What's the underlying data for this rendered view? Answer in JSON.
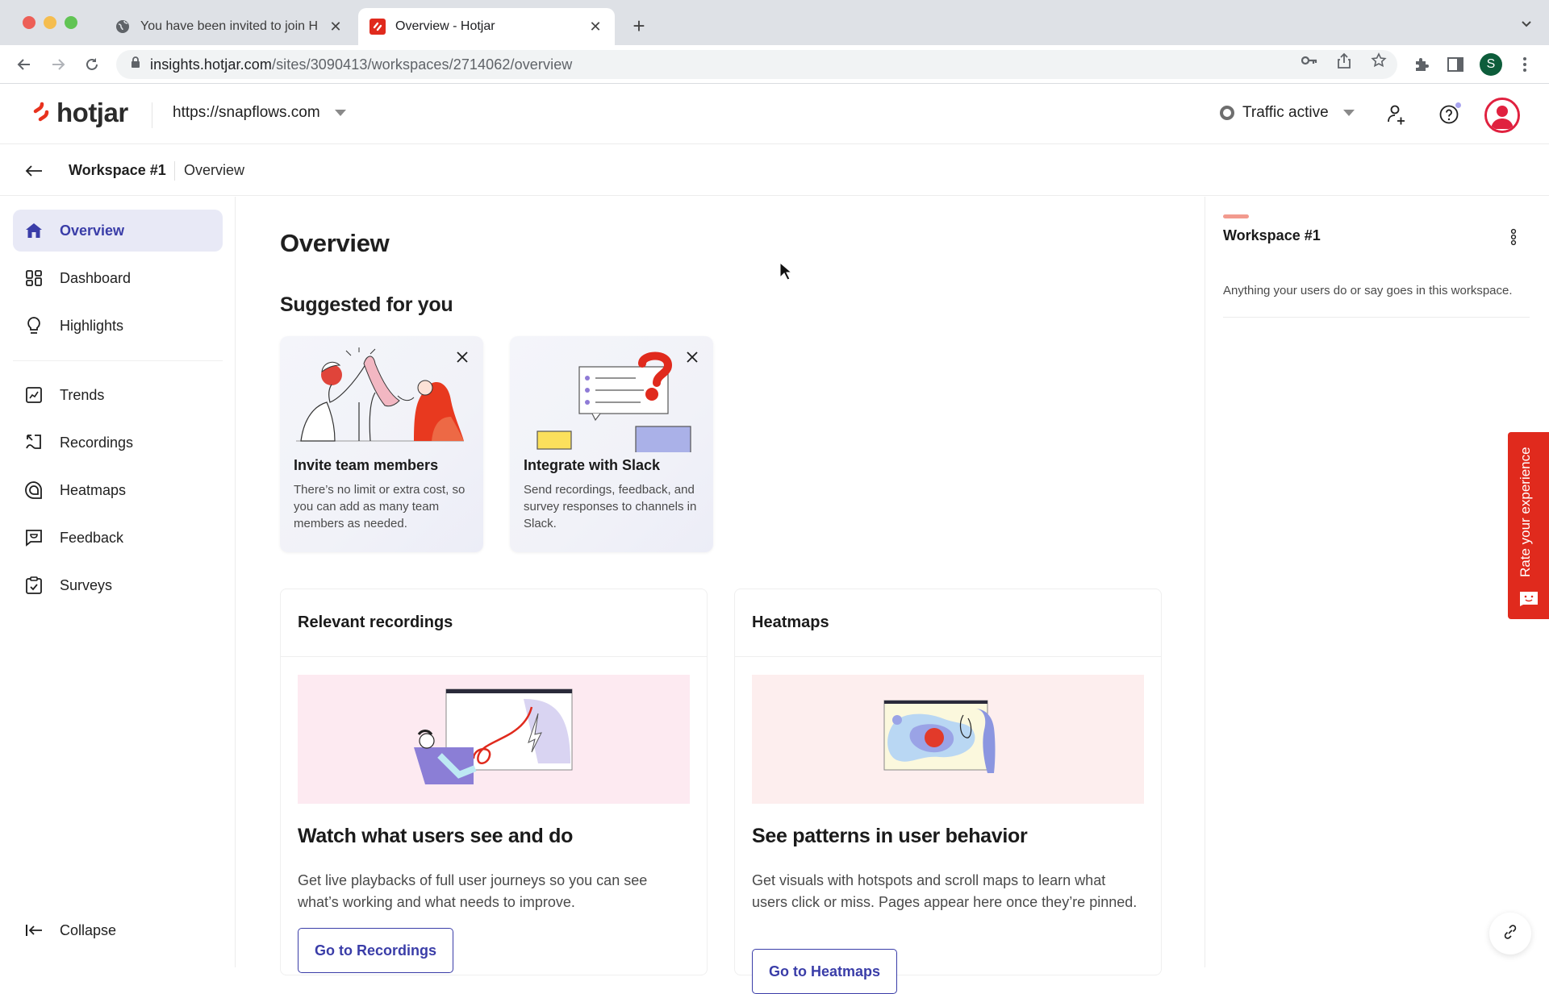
{
  "browser": {
    "tabs": [
      {
        "title": "You have been invited to join H",
        "icon": "globe-icon",
        "active": false
      },
      {
        "title": "Overview - Hotjar",
        "icon": "hotjar-favicon",
        "active": true
      }
    ],
    "url_host": "insights.hotjar.com",
    "url_path": "/sites/3090413/workspaces/2714062/overview",
    "profile_initial": "S"
  },
  "header": {
    "logo_text": "hotjar",
    "site": "https://snapflows.com",
    "traffic_status": "Traffic active"
  },
  "breadcrumb": {
    "workspace": "Workspace #1",
    "page": "Overview"
  },
  "sidebar": {
    "items": [
      {
        "label": "Overview",
        "icon": "home-icon",
        "active": true
      },
      {
        "label": "Dashboard",
        "icon": "dashboard-icon",
        "active": false
      },
      {
        "label": "Highlights",
        "icon": "lightbulb-icon",
        "active": false
      },
      {
        "label": "Trends",
        "icon": "trends-icon",
        "active": false
      },
      {
        "label": "Recordings",
        "icon": "recordings-icon",
        "active": false
      },
      {
        "label": "Heatmaps",
        "icon": "heatmaps-icon",
        "active": false
      },
      {
        "label": "Feedback",
        "icon": "feedback-icon",
        "active": false
      },
      {
        "label": "Surveys",
        "icon": "surveys-icon",
        "active": false
      }
    ],
    "collapse_label": "Collapse"
  },
  "main": {
    "title": "Overview",
    "suggested_title": "Suggested for you",
    "suggestions": [
      {
        "title": "Invite team members",
        "description": "There’s no limit or extra cost, so you can add as many team members as needed."
      },
      {
        "title": "Integrate with Slack",
        "description": "Send recordings, feedback, and survey responses to channels in Slack."
      }
    ],
    "features": [
      {
        "header": "Relevant recordings",
        "title": "Watch what users see and do",
        "description": "Get live playbacks of full user journeys so you can see what’s working and what needs to improve.",
        "button": "Go to Recordings"
      },
      {
        "header": "Heatmaps",
        "title": "See patterns in user behavior",
        "description": "Get visuals with hotspots and scroll maps to learn what users click or miss. Pages appear here once they’re pinned.",
        "button": "Go to Heatmaps"
      }
    ]
  },
  "right_panel": {
    "title": "Workspace #1",
    "description": "Anything your users do or say goes in this workspace."
  },
  "feedback_tab": {
    "label": "Rate your experience"
  },
  "colors": {
    "brand_red": "#e02a1d",
    "accent_indigo": "#3a3da8",
    "active_nav_bg": "#e8e9f6"
  }
}
